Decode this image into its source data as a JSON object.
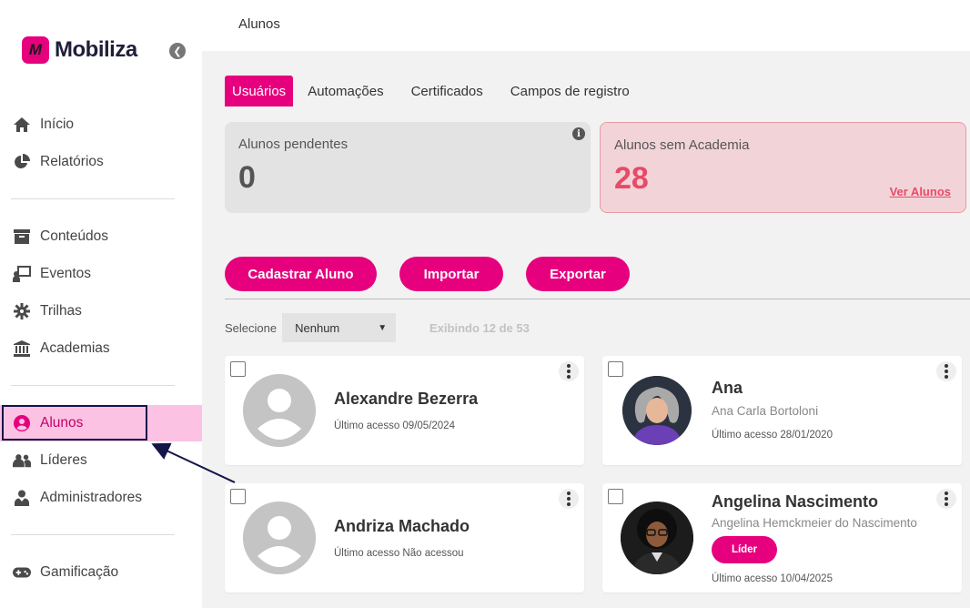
{
  "brand": {
    "name": "Mobiliza",
    "mark": "M"
  },
  "sidebar": {
    "items": [
      {
        "label": "Início",
        "icon": "home-icon"
      },
      {
        "label": "Relatórios",
        "icon": "pie-chart-icon"
      },
      {
        "label": "Conteúdos",
        "icon": "archive-icon"
      },
      {
        "label": "Eventos",
        "icon": "presentation-icon"
      },
      {
        "label": "Trilhas",
        "icon": "gear-icon"
      },
      {
        "label": "Academias",
        "icon": "bank-icon"
      },
      {
        "label": "Alunos",
        "icon": "user-circle-icon"
      },
      {
        "label": "Líderes",
        "icon": "users-icon"
      },
      {
        "label": "Administradores",
        "icon": "user-tie-icon"
      },
      {
        "label": "Gamificação",
        "icon": "gamepad-icon"
      }
    ]
  },
  "header": {
    "title": "Alunos"
  },
  "tabs": [
    {
      "label": "Usuários"
    },
    {
      "label": "Automações"
    },
    {
      "label": "Certificados"
    },
    {
      "label": "Campos de registro"
    }
  ],
  "stats": {
    "pending": {
      "label": "Alunos pendentes",
      "value": "0",
      "info": "i"
    },
    "academy": {
      "label": "Alunos sem Academia",
      "value": "28",
      "link": "Ver Alunos"
    }
  },
  "actions": {
    "cadastrar": "Cadastrar Aluno",
    "importar": "Importar",
    "exportar": "Exportar"
  },
  "selection": {
    "label": "Selecione",
    "value": "Nenhum",
    "showing": "Exibindo 12 de 53"
  },
  "students": [
    {
      "name": "Alexandre Bezerra",
      "fullname": "",
      "access": "Último acesso 09/05/2024",
      "badge": ""
    },
    {
      "name": "Ana",
      "fullname": "Ana Carla Bortoloni",
      "access": "Último acesso 28/01/2020",
      "badge": ""
    },
    {
      "name": "Andriza Machado",
      "fullname": "",
      "access": "Último acesso Não acessou",
      "badge": ""
    },
    {
      "name": "Angelina Nascimento",
      "fullname": "Angelina Hemckmeier do Nascimento",
      "access": "Último acesso 10/04/2025",
      "badge": "Líder"
    }
  ],
  "colors": {
    "brand": "#e6007e",
    "active_nav_bg": "#fbc2e3",
    "alert": "#e84a67",
    "alert_bg": "#f2d4d8"
  }
}
